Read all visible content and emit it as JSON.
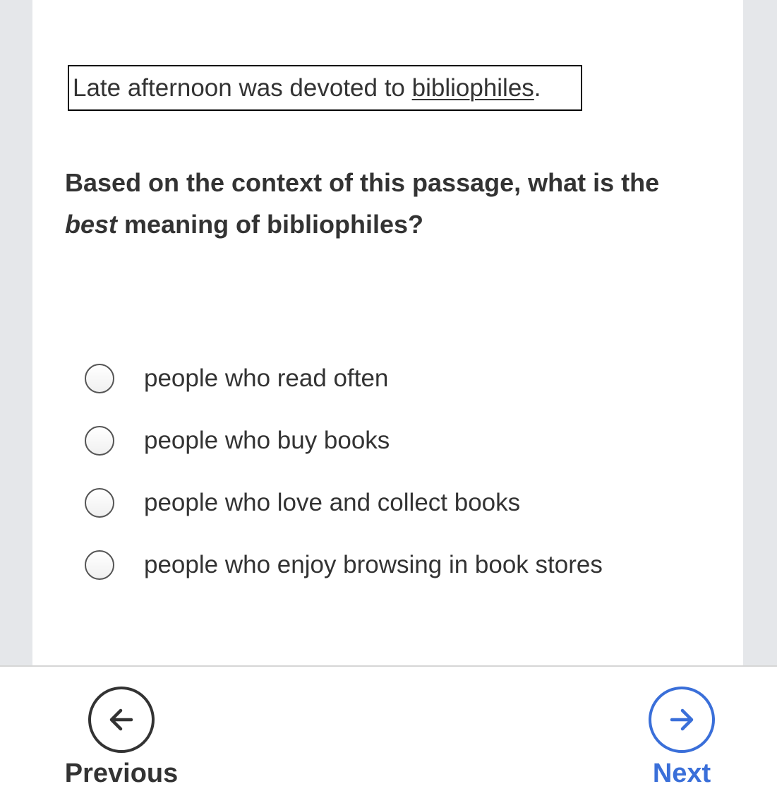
{
  "passage": {
    "text_before": "Late afternoon was devoted to ",
    "underlined_word": "bibliophiles",
    "text_after": "."
  },
  "question": {
    "part1": "Based on the context of this passage, what is the ",
    "emphasis": "best",
    "part2": " meaning of bibliophiles?"
  },
  "options": [
    {
      "label": "people who read often",
      "selected": false
    },
    {
      "label": "people who buy books",
      "selected": false
    },
    {
      "label": "people who love and collect books",
      "selected": false
    },
    {
      "label": "people who enjoy browsing in book stores",
      "selected": false
    }
  ],
  "navigation": {
    "previous_label": "Previous",
    "next_label": "Next",
    "previous_icon": "arrow-left-icon",
    "next_icon": "arrow-right-icon"
  },
  "colors": {
    "text": "#333333",
    "accent": "#3a6fd9",
    "background": "#e5e7ea",
    "card": "#ffffff"
  }
}
